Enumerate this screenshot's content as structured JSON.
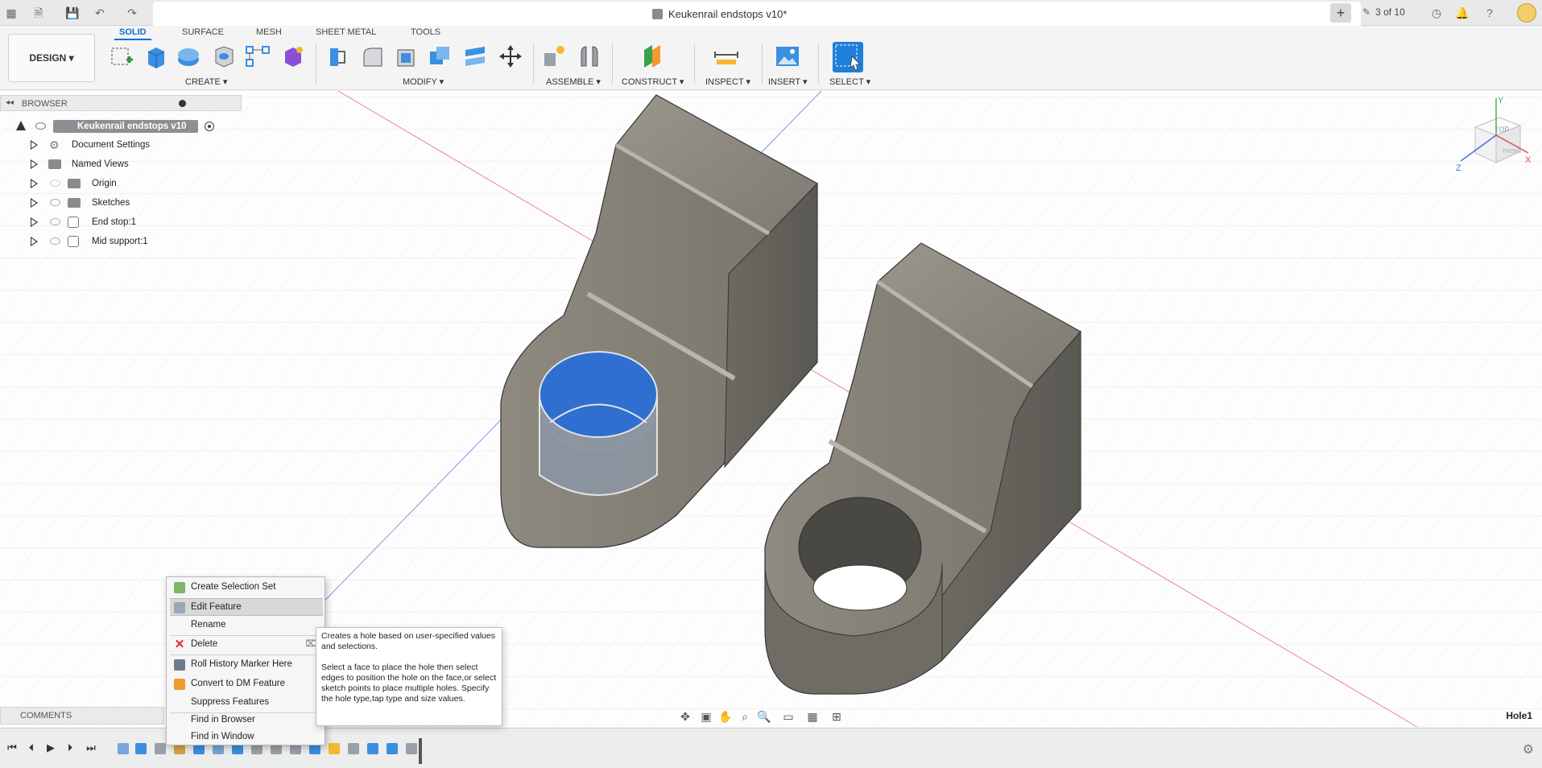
{
  "window": {
    "title": "Keukenrail endstops v10*",
    "job_status": "3 of 10"
  },
  "toolbar": {
    "workspace": "DESIGN",
    "tabs": [
      {
        "label": "SOLID",
        "active": true
      },
      {
        "label": "SURFACE",
        "active": false
      },
      {
        "label": "MESH",
        "active": false
      },
      {
        "label": "SHEET METAL",
        "active": false
      },
      {
        "label": "TOOLS",
        "active": false
      }
    ],
    "groups": {
      "create": "CREATE ▾",
      "modify": "MODIFY ▾",
      "assemble": "ASSEMBLE ▾",
      "construct": "CONSTRUCT ▾",
      "inspect": "INSPECT ▾",
      "insert": "INSERT ▾",
      "select": "SELECT ▾"
    }
  },
  "browser": {
    "title": "BROWSER",
    "root": "Keukenrail endstops v10",
    "items": [
      {
        "label": "Document Settings",
        "icon": "gear-icon"
      },
      {
        "label": "Named Views",
        "icon": "folder-icon"
      },
      {
        "label": "Origin",
        "icon": "folder-icon"
      },
      {
        "label": "Sketches",
        "icon": "folder-icon"
      },
      {
        "label": "End stop:1",
        "icon": "component-icon"
      },
      {
        "label": "Mid support:1",
        "icon": "component-icon"
      }
    ]
  },
  "viewcube": {
    "top": "TOP",
    "front": "FRONT",
    "axis_x": "X",
    "axis_y": "Y",
    "axis_z": "Z"
  },
  "context_menu": {
    "items": [
      {
        "label": "Create Selection Set"
      },
      {
        "label": "Edit Feature",
        "highlighted": true
      },
      {
        "label": "Rename"
      },
      {
        "label": "Delete"
      },
      {
        "label": "Roll History Marker Here"
      },
      {
        "label": "Convert to DM Feature"
      },
      {
        "label": "Suppress Features"
      },
      {
        "label": "Find in Browser"
      },
      {
        "label": "Find in Window"
      }
    ]
  },
  "tooltip": {
    "line1": "Creates a hole based on user-specified values and selections.",
    "line2": "Select a face to place the hole then select edges to position the hole on the face,or select sketch points to place multiple holes. Specify the hole type,tap type and size values."
  },
  "comments": {
    "label": "COMMENTS"
  },
  "status": {
    "selection": "Hole1"
  },
  "colors": {
    "accent": "#0a6ed1",
    "selection_blue": "#2f6fd0",
    "model_gray": "#7d7a72"
  }
}
